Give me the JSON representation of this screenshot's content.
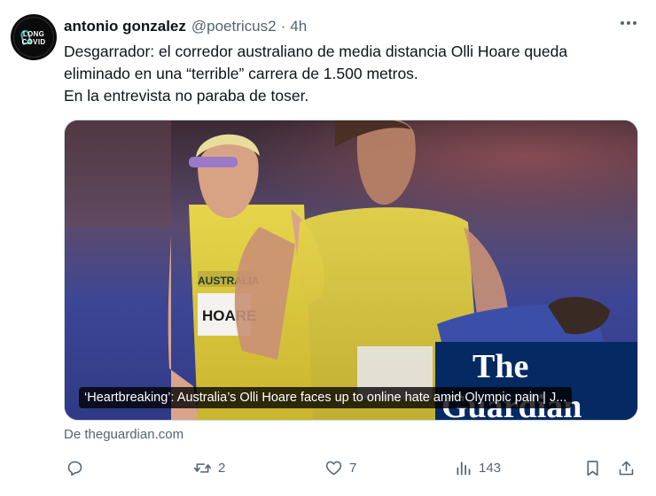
{
  "author": {
    "display_name": "antonio gonzalez",
    "handle": "@poetricus2",
    "separator": "·",
    "time": "4h",
    "avatar_text_top": "LONG",
    "avatar_text_bottom": "COVID"
  },
  "tweet": {
    "lines": [
      "Desgarrador: el corredor australiano de media distancia Olli Hoare queda",
      "eliminado en una “terrible” carrera de 1.500 metros.",
      "En la entrevista no paraba de toser."
    ]
  },
  "card": {
    "title": "‘Heartbreaking’: Australia’s Olli Hoare faces up to online hate amid Olympic pain | J...",
    "watermark": "The Guardian",
    "jersey_text": "AUSTRALIA",
    "bib_text": "HOARE",
    "image_description_icon": "photo-runners"
  },
  "source": {
    "label": "De theguardian.com"
  },
  "actions": {
    "reply_count": "",
    "repost_count": "2",
    "like_count": "7",
    "views_count": "143"
  },
  "colors": {
    "text_primary": "#0f1419",
    "text_secondary": "#536471",
    "border": "#cfd9de",
    "guardian_blue": "#052962"
  }
}
